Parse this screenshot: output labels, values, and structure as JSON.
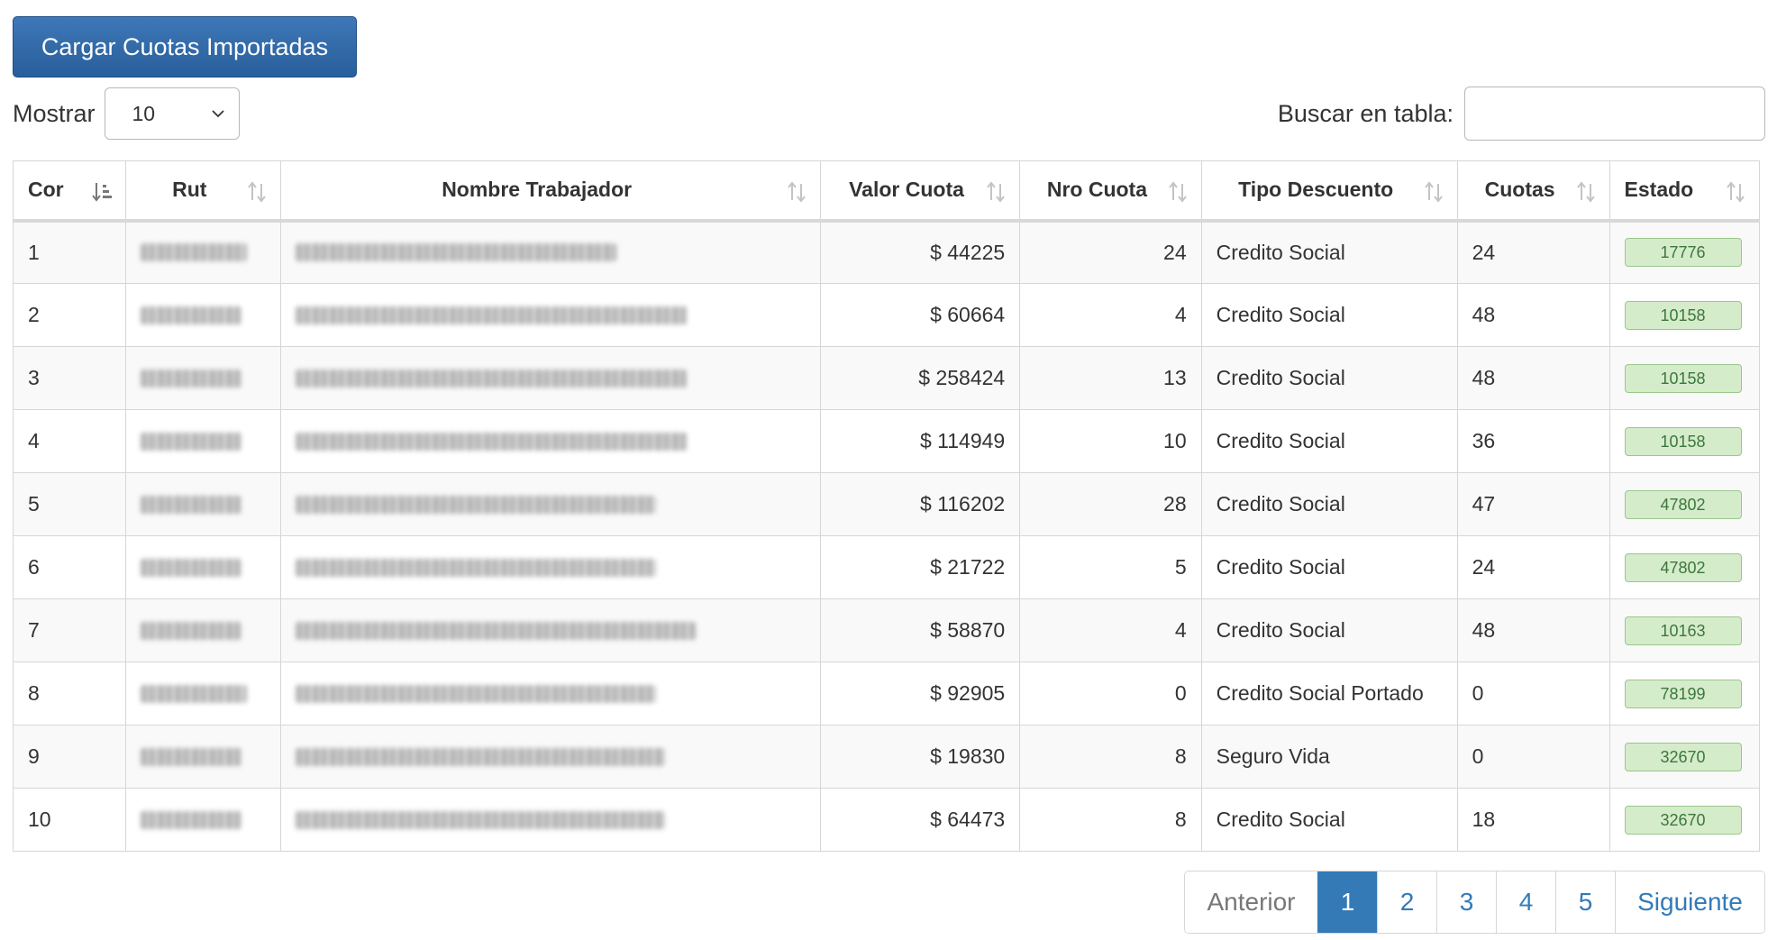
{
  "toolbar": {
    "load_button": "Cargar Cuotas Importadas"
  },
  "length_control": {
    "label": "Mostrar",
    "selected": "10"
  },
  "search": {
    "label": "Buscar en tabla:",
    "value": "",
    "placeholder": ""
  },
  "table": {
    "headers": [
      "Cor",
      "Rut",
      "Nombre Trabajador",
      "Valor Cuota",
      "Nro Cuota",
      "Tipo Descuento",
      "Cuotas",
      "Estado"
    ],
    "rows": [
      {
        "cor": "1",
        "valor": "$ 44225",
        "nro": "24",
        "tipo": "Credito Social",
        "cuotas": "24",
        "estado": "17776"
      },
      {
        "cor": "2",
        "valor": "$ 60664",
        "nro": "4",
        "tipo": "Credito Social",
        "cuotas": "48",
        "estado": "10158"
      },
      {
        "cor": "3",
        "valor": "$ 258424",
        "nro": "13",
        "tipo": "Credito Social",
        "cuotas": "48",
        "estado": "10158"
      },
      {
        "cor": "4",
        "valor": "$ 114949",
        "nro": "10",
        "tipo": "Credito Social",
        "cuotas": "36",
        "estado": "10158"
      },
      {
        "cor": "5",
        "valor": "$ 116202",
        "nro": "28",
        "tipo": "Credito Social",
        "cuotas": "47",
        "estado": "47802"
      },
      {
        "cor": "6",
        "valor": "$ 21722",
        "nro": "5",
        "tipo": "Credito Social",
        "cuotas": "24",
        "estado": "47802"
      },
      {
        "cor": "7",
        "valor": "$ 58870",
        "nro": "4",
        "tipo": "Credito Social",
        "cuotas": "48",
        "estado": "10163"
      },
      {
        "cor": "8",
        "valor": "$ 92905",
        "nro": "0",
        "tipo": "Credito Social Portado",
        "cuotas": "0",
        "estado": "78199"
      },
      {
        "cor": "9",
        "valor": "$ 19830",
        "nro": "8",
        "tipo": "Seguro Vida",
        "cuotas": "0",
        "estado": "32670"
      },
      {
        "cor": "10",
        "valor": "$ 64473",
        "nro": "8",
        "tipo": "Credito Social",
        "cuotas": "18",
        "estado": "32670"
      }
    ]
  },
  "pagination": {
    "previous": "Anterior",
    "pages": [
      "1",
      "2",
      "3",
      "4",
      "5"
    ],
    "active_page": "1",
    "next": "Siguiente"
  },
  "colors": {
    "primary": "#337ab7",
    "button_top": "#3e78b8",
    "button_bottom": "#285e9a",
    "badge_bg": "#d5eccb",
    "badge_border": "#9bc68b",
    "badge_text": "#3c763d"
  },
  "icons": {
    "sorted_column_icon": "sort-amount-down-icon",
    "sortable_column_icon": "sort-both-icon",
    "select_icon": "chevron-down-icon"
  }
}
